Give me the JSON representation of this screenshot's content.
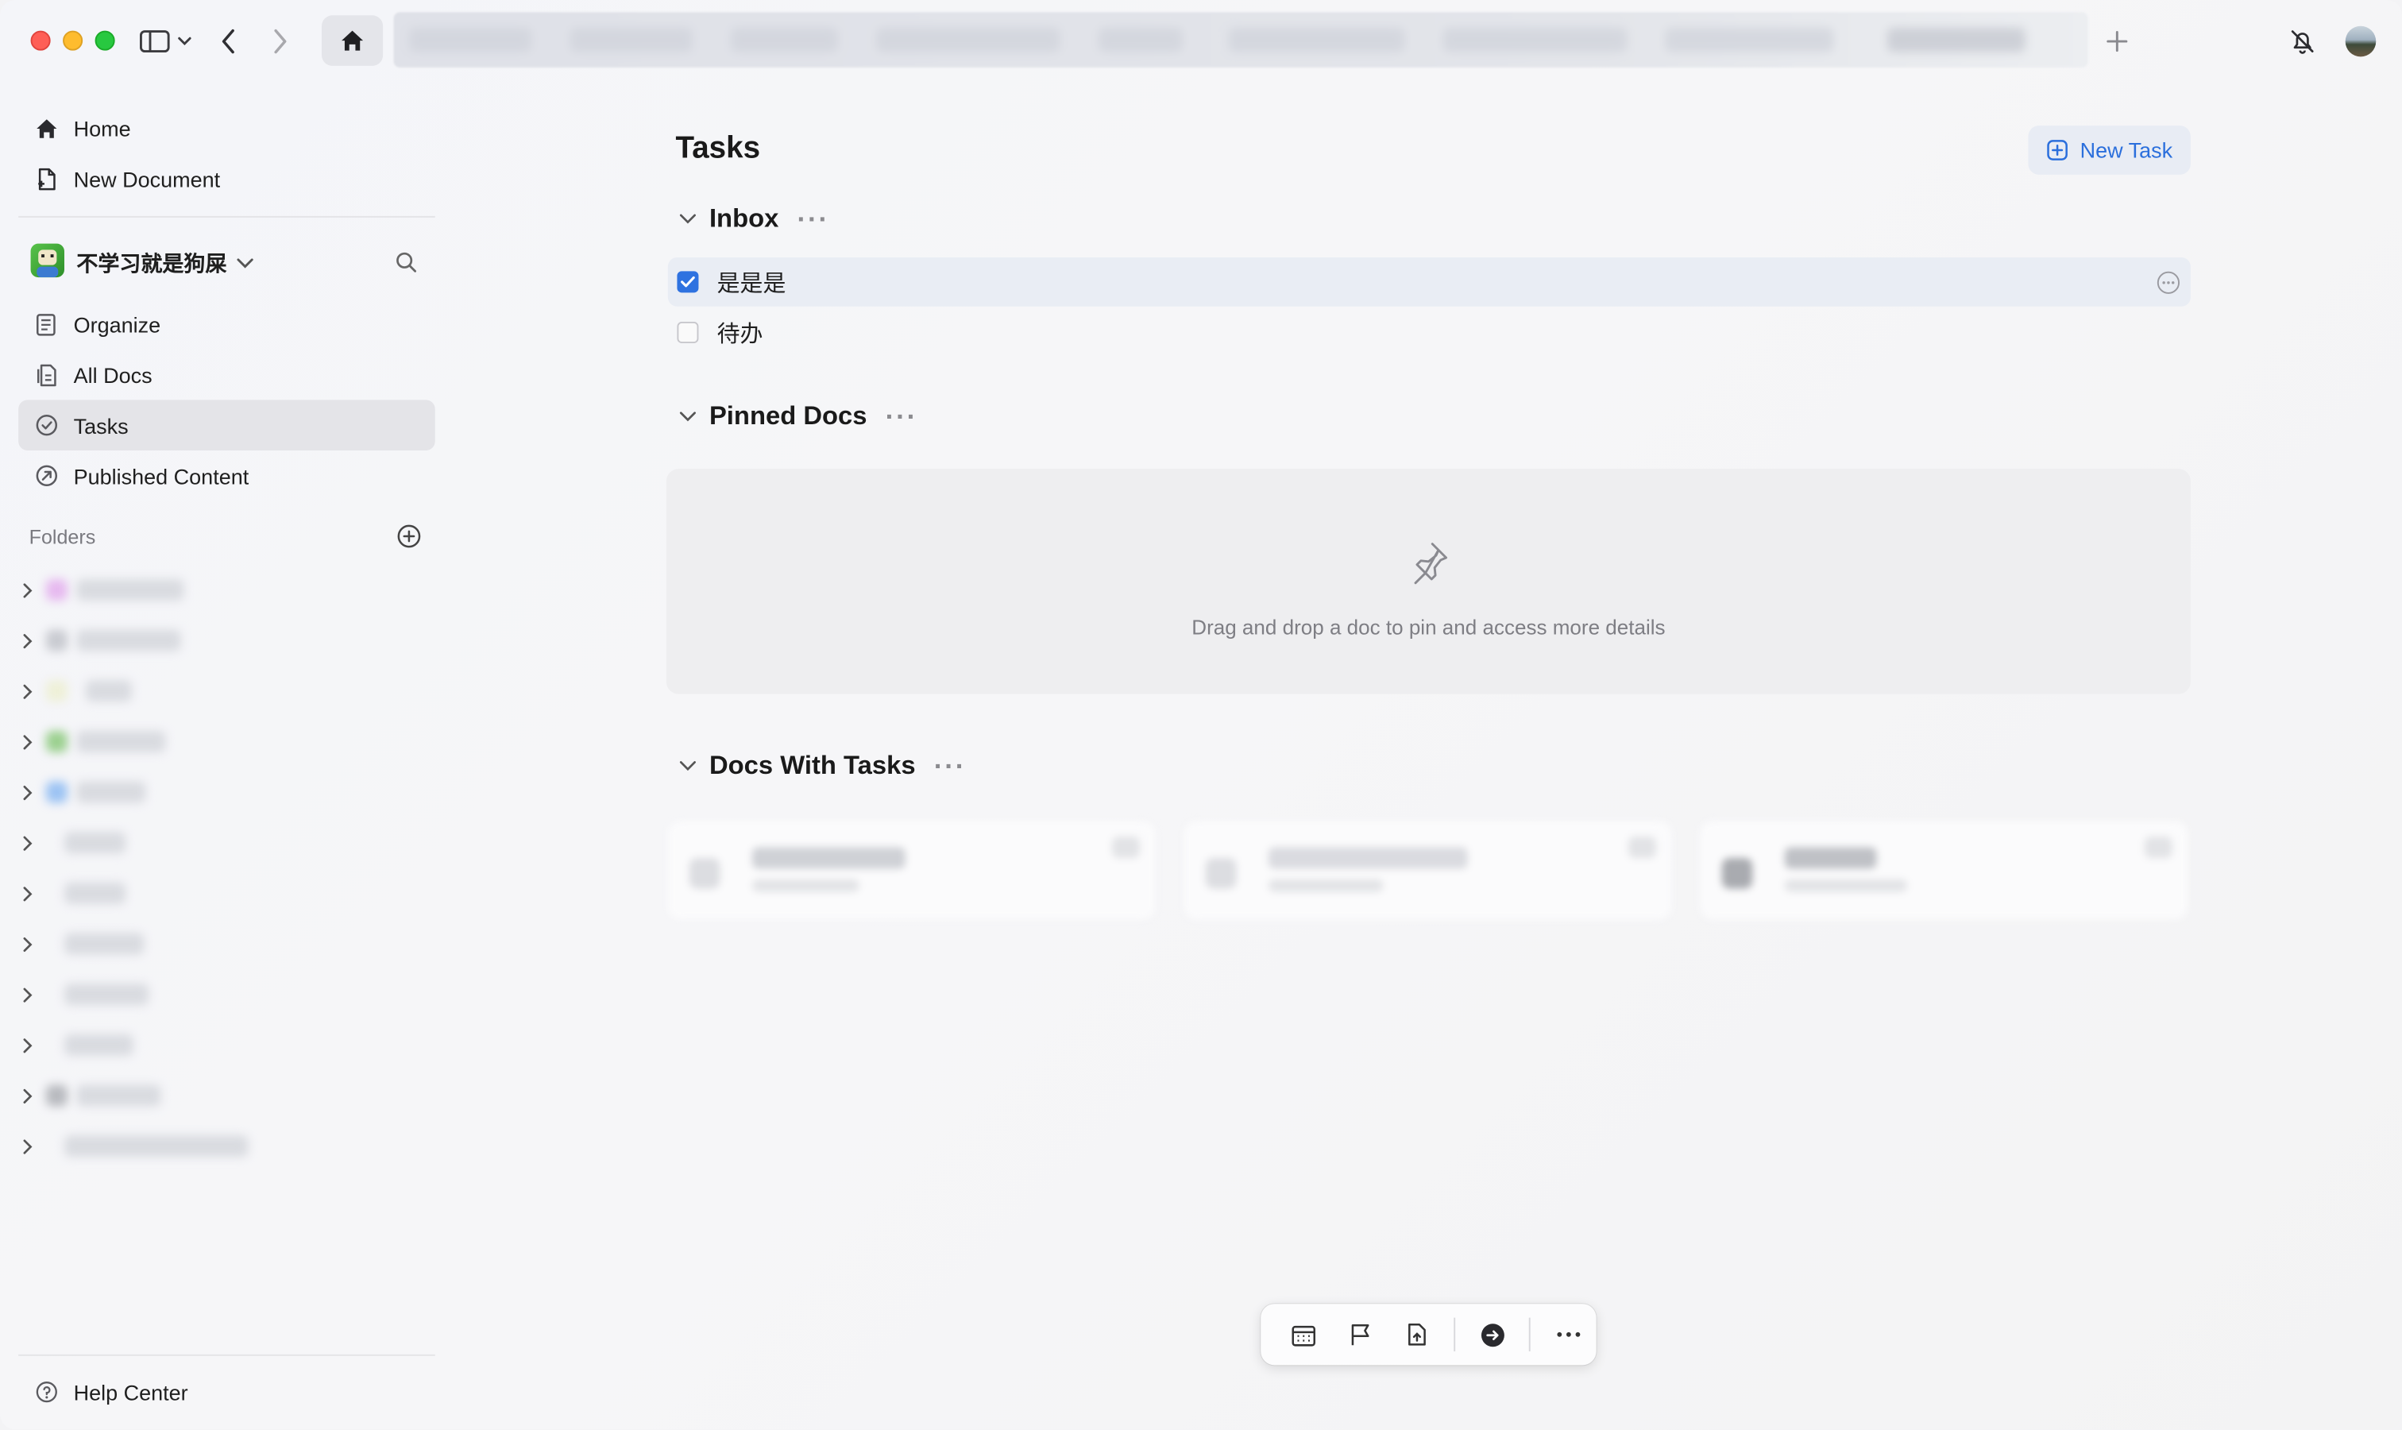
{
  "window": {
    "home_tab": "home-icon",
    "new_tab": "plus-icon"
  },
  "sidebar": {
    "top": [
      {
        "label": "Home",
        "icon": "home-icon"
      },
      {
        "label": "New Document",
        "icon": "new-document-icon"
      }
    ],
    "workspace": {
      "name": "不学习就是狗屎",
      "icon": "workspace-avatar"
    },
    "items": [
      {
        "label": "Organize",
        "icon": "organize-icon"
      },
      {
        "label": "All Docs",
        "icon": "all-docs-icon"
      },
      {
        "label": "Tasks",
        "icon": "tasks-icon",
        "active": true
      },
      {
        "label": "Published Content",
        "icon": "published-icon"
      }
    ],
    "folders_label": "Folders",
    "help": "Help Center"
  },
  "main": {
    "title": "Tasks",
    "new_task": "New Task",
    "inbox": {
      "title": "Inbox",
      "tasks": [
        {
          "label": "是是是",
          "done": true
        },
        {
          "label": "待办",
          "done": false
        }
      ]
    },
    "pinned": {
      "title": "Pinned Docs",
      "empty_message": "Drag and drop a doc to pin and access more details"
    },
    "docs_with_tasks": {
      "title": "Docs With Tasks"
    }
  },
  "toolbar": {
    "items": [
      "calendar-icon",
      "flag-icon",
      "upload-doc-icon",
      "arrow-right-circle-icon",
      "more-icon"
    ]
  },
  "colors": {
    "accent": "#2e72e0",
    "active_nav": "#e4e4e8"
  }
}
